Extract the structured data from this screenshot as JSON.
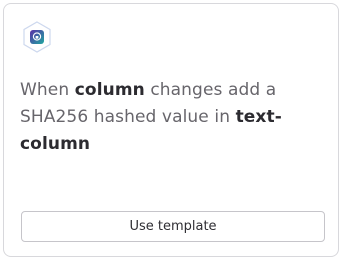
{
  "card": {
    "icon": "hashing-tool-app-icon",
    "description": {
      "part1": "When ",
      "bold1": "column",
      "part2": " changes add a SHA256 hashed value in ",
      "bold2": "text-column"
    },
    "button_label": "Use template"
  },
  "colors": {
    "icon_hex_border": "#cdd8ee",
    "icon_gradient_start": "#5a2fa8",
    "icon_gradient_end": "#1fa7a0",
    "text_muted": "#67656b",
    "text_bold": "#2c2b30"
  }
}
